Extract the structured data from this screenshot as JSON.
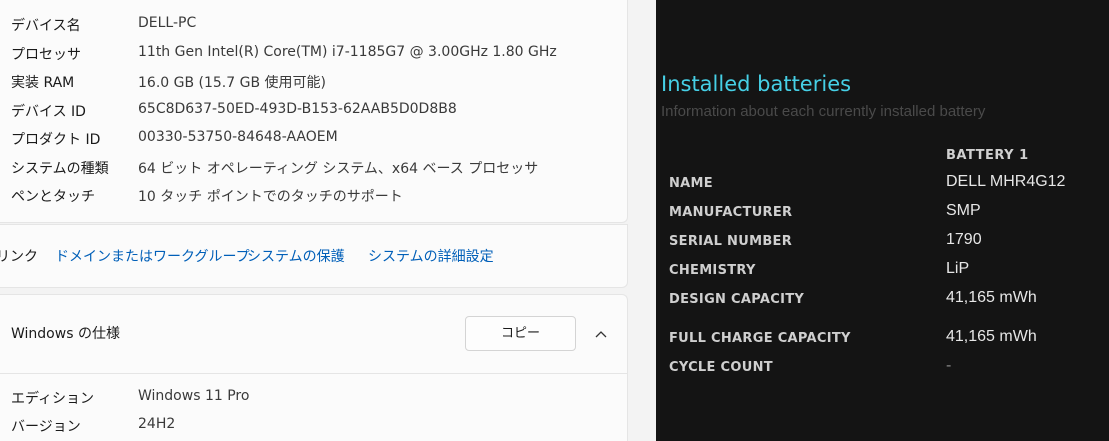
{
  "device_specs": [
    {
      "label": "デバイス名",
      "value": "DELL-PC"
    },
    {
      "label": "プロセッサ",
      "value": "11th Gen Intel(R) Core(TM) i7-1185G7 @ 3.00GHz   1.80 GHz"
    },
    {
      "label": "実装 RAM",
      "value": "16.0 GB (15.7 GB 使用可能)"
    },
    {
      "label": "デバイス ID",
      "value": "65C8D637-50ED-493D-B153-62AAB5D0D8B8"
    },
    {
      "label": "プロダクト ID",
      "value": "00330-53750-84648-AAOEM"
    },
    {
      "label": "システムの種類",
      "value": "64 ビット オペレーティング システム、x64 ベース プロセッサ"
    },
    {
      "label": "ペンとタッチ",
      "value": "10 タッチ ポイントでのタッチのサポート"
    }
  ],
  "related_links": {
    "label": "リンク",
    "links": [
      "ドメインまたはワークグループ",
      "システムの保護",
      "システムの詳細設定"
    ]
  },
  "windows_spec": {
    "title": "Windows の仕様",
    "copy_label": "コピー",
    "rows": [
      {
        "label": "エディション",
        "value": "Windows 11 Pro"
      },
      {
        "label": "バージョン",
        "value": "24H2"
      }
    ]
  },
  "battery_report": {
    "title": "Installed batteries",
    "subtitle": "Information about each currently installed battery",
    "column_header": "BATTERY 1",
    "rows": [
      {
        "key": "NAME",
        "value": "DELL MHR4G12"
      },
      {
        "key": "MANUFACTURER",
        "value": "SMP"
      },
      {
        "key": "SERIAL NUMBER",
        "value": "1790"
      },
      {
        "key": "CHEMISTRY",
        "value": "LiP"
      },
      {
        "key": "DESIGN CAPACITY",
        "value": "41,165 mWh"
      },
      {
        "key": "FULL CHARGE CAPACITY",
        "value": "41,165 mWh"
      },
      {
        "key": "CYCLE COUNT",
        "value": "-"
      }
    ]
  },
  "colors": {
    "link": "#005fb8",
    "battery_title": "#46d0e6",
    "battery_bg": "#141414"
  }
}
